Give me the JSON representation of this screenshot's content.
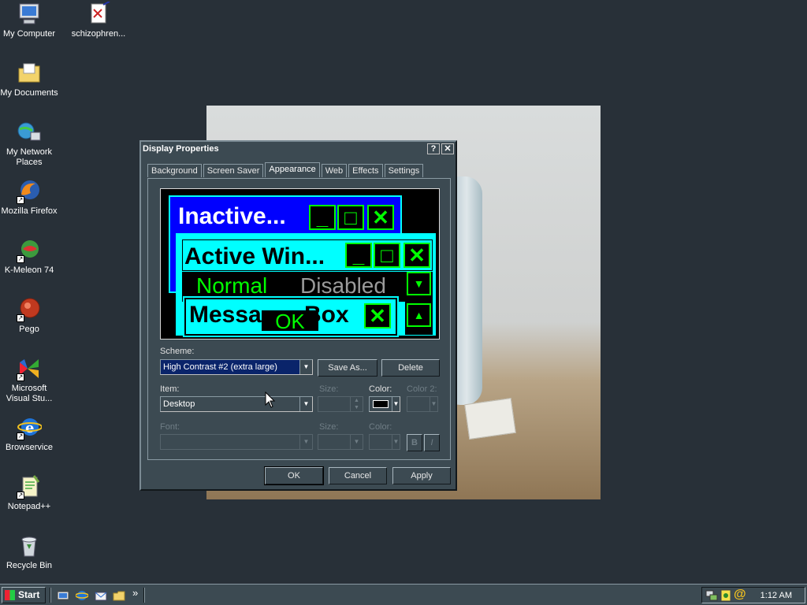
{
  "desktop": {
    "icons": [
      {
        "label": "My Computer"
      },
      {
        "label": "schizophren..."
      },
      {
        "label": "My Documents"
      },
      {
        "label": "My Network Places"
      },
      {
        "label": "Mozilla Firefox"
      },
      {
        "label": "K-Meleon 74"
      },
      {
        "label": "Pego"
      },
      {
        "label": "Microsoft Visual Stu..."
      },
      {
        "label": "Browservice"
      },
      {
        "label": "Notepad++"
      },
      {
        "label": "Recycle Bin"
      }
    ]
  },
  "dialog": {
    "title": "Display Properties",
    "help_btn": "?",
    "close_btn": "✕",
    "tabs": [
      {
        "label": "Background"
      },
      {
        "label": "Screen Saver"
      },
      {
        "label": "Appearance",
        "active": true
      },
      {
        "label": "Web"
      },
      {
        "label": "Effects"
      },
      {
        "label": "Settings"
      }
    ],
    "preview": {
      "inactive_title": "Inactive...",
      "active_title": "Active Win...",
      "normal_text": "Normal",
      "disabled_text": "Disabled",
      "message_title": "Messa",
      "message_title_tail": "Box",
      "ok_label": "OK",
      "min_glyph": "_",
      "max_glyph": "□",
      "close_glyph": "✕",
      "down_glyph": "▼",
      "up_glyph": "▲"
    },
    "scheme_label": "Scheme:",
    "scheme_value": "High Contrast #2 (extra large)",
    "save_as_label": "Save As...",
    "delete_label": "Delete",
    "item_label": "Item:",
    "item_value": "Desktop",
    "size_label": "Size:",
    "color_label": "Color:",
    "color2_label": "Color 2:",
    "font_label": "Font:",
    "font_size_label": "Size:",
    "font_color_label": "Color:",
    "bold_label": "B",
    "italic_label": "I",
    "ok_label": "OK",
    "cancel_label": "Cancel",
    "apply_label": "Apply"
  },
  "taskbar": {
    "start_label": "Start",
    "overflow_glyph": "»",
    "clock": "1:12 AM"
  },
  "colors": {
    "desktop": "#283038",
    "dialog_face": "#3c4a52",
    "high_contrast_green": "#00ff00",
    "high_contrast_cyan": "#00ffff",
    "high_contrast_blue": "#0000ff"
  }
}
